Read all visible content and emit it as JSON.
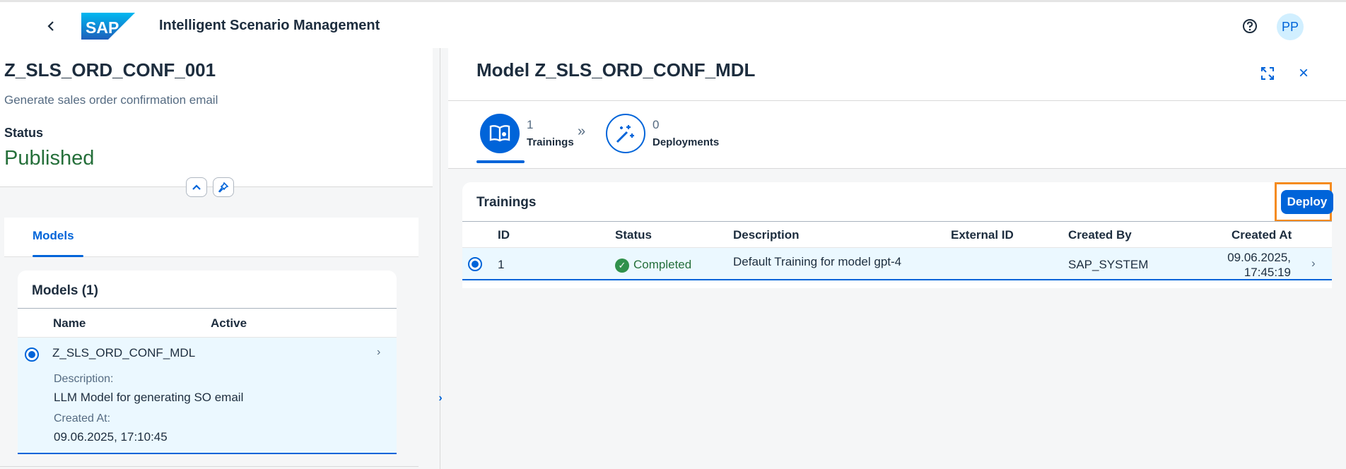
{
  "shell": {
    "app_title": "Intelligent Scenario Management",
    "avatar_initials": "PP",
    "logo_text": "SAP"
  },
  "scenario": {
    "title": "Z_SLS_ORD_CONF_001",
    "subtitle": "Generate sales order confirmation email",
    "status_label": "Status",
    "status_value": "Published",
    "status_color": "#256f3a"
  },
  "tabs": [
    {
      "label": "Models",
      "selected": true
    }
  ],
  "models_table": {
    "title": "Models (1)",
    "columns": [
      "Name",
      "Active"
    ],
    "rows": [
      {
        "name": "Z_SLS_ORD_CONF_MDL",
        "description_label": "Description:",
        "description": "LLM Model for generating SO email",
        "created_at_label": "Created At:",
        "created_at": "09.06.2025, 17:10:45"
      }
    ]
  },
  "model_panel": {
    "title": "Model Z_SLS_ORD_CONF_MDL",
    "steps": [
      {
        "count": "1",
        "label": "Trainings",
        "selected": true,
        "icon": "book-icon"
      },
      {
        "count": "0",
        "label": "Deployments",
        "selected": false,
        "icon": "magic-wand-icon"
      }
    ]
  },
  "trainings_table": {
    "title": "Trainings",
    "deploy_label": "Deploy",
    "columns": [
      "ID",
      "Status",
      "Description",
      "External ID",
      "Created By",
      "Created At"
    ],
    "rows": [
      {
        "id": "1",
        "status": "Completed",
        "description": "Default Training for model gpt-4",
        "external_id": "",
        "created_by": "SAP_SYSTEM",
        "created_at_date": "09.06.2025,",
        "created_at_time": "17:45:19"
      }
    ]
  },
  "colors": {
    "accent": "#0064d9",
    "success": "#30914c",
    "highlight": "#f58b1f"
  }
}
